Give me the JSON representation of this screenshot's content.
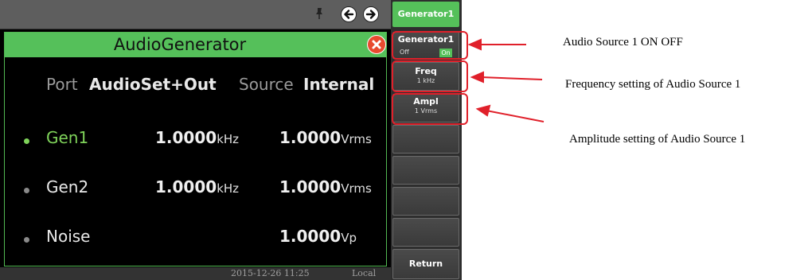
{
  "topbar": {
    "pin_icon": "pin-icon",
    "back_icon": "arrow-left-circle-icon",
    "forward_icon": "arrow-right-circle-icon"
  },
  "dialog": {
    "title": "AudioGenerator",
    "close_icon": "close-circle-icon",
    "port_label": "Port",
    "port_value": "AudioSet+Out",
    "source_label": "Source",
    "source_value": "Internal",
    "rows": [
      {
        "name": "Gen1",
        "freq": "1.0000",
        "freq_unit": "kHz",
        "amp": "1.0000",
        "amp_unit": "Vrms",
        "active": true
      },
      {
        "name": "Gen2",
        "freq": "1.0000",
        "freq_unit": "kHz",
        "amp": "1.0000",
        "amp_unit": "Vrms",
        "active": false
      },
      {
        "name": "Noise",
        "freq": "",
        "freq_unit": "",
        "amp": "1.0000",
        "amp_unit": "Vp",
        "active": false
      }
    ]
  },
  "status": {
    "datetime": "2015-12-26 11:25",
    "mode": "Local"
  },
  "panel": {
    "header": "Generator1",
    "gen_key": {
      "label": "Generator1",
      "off": "Off",
      "on": "On"
    },
    "freq_key": {
      "label": "Freq",
      "value": "1 kHz"
    },
    "ampl_key": {
      "label": "Ampl",
      "value": "1 Vrms"
    },
    "return_key": {
      "label": "Return"
    }
  },
  "annotations": {
    "source_on_off": "Audio Source 1 ON    OFF",
    "freq_setting": "Frequency setting of Audio Source 1",
    "ampl_setting": "Amplitude setting of Audio Source 1"
  },
  "colors": {
    "accent_green": "#55c05a",
    "annotation_red": "#e0202a",
    "close_red": "#e84a2f",
    "active_text": "#7fd35a"
  }
}
